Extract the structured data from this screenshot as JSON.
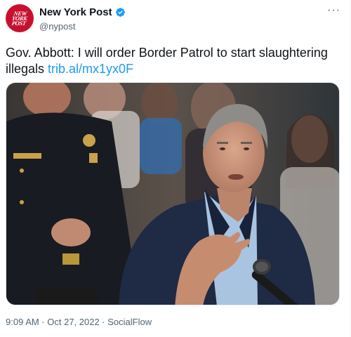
{
  "account": {
    "display_name": "New York Post",
    "handle": "@nypost",
    "avatar_logo": "NEW YORK POST",
    "verified": true
  },
  "tweet": {
    "text": "Gov. Abbott: I will order Border Patrol to start slaughtering illegals ",
    "link": "trib.al/mx1yx0F"
  },
  "media": {
    "icon": "photo-image",
    "description_colors": {
      "suit": "#1f2a44",
      "shirt": "#a9c4e0",
      "background": "#5a5049"
    }
  },
  "meta": {
    "timestamp": "9:09 AM · Oct 27, 2022 · SocialFlow"
  },
  "icons": {
    "more": "more-horizontal-icon",
    "verified": "verified-badge-icon"
  },
  "colors": {
    "link": "#1d9bf0",
    "verified": "#1d9bf0",
    "avatar": "#c8102e",
    "secondary_text": "#536471"
  }
}
